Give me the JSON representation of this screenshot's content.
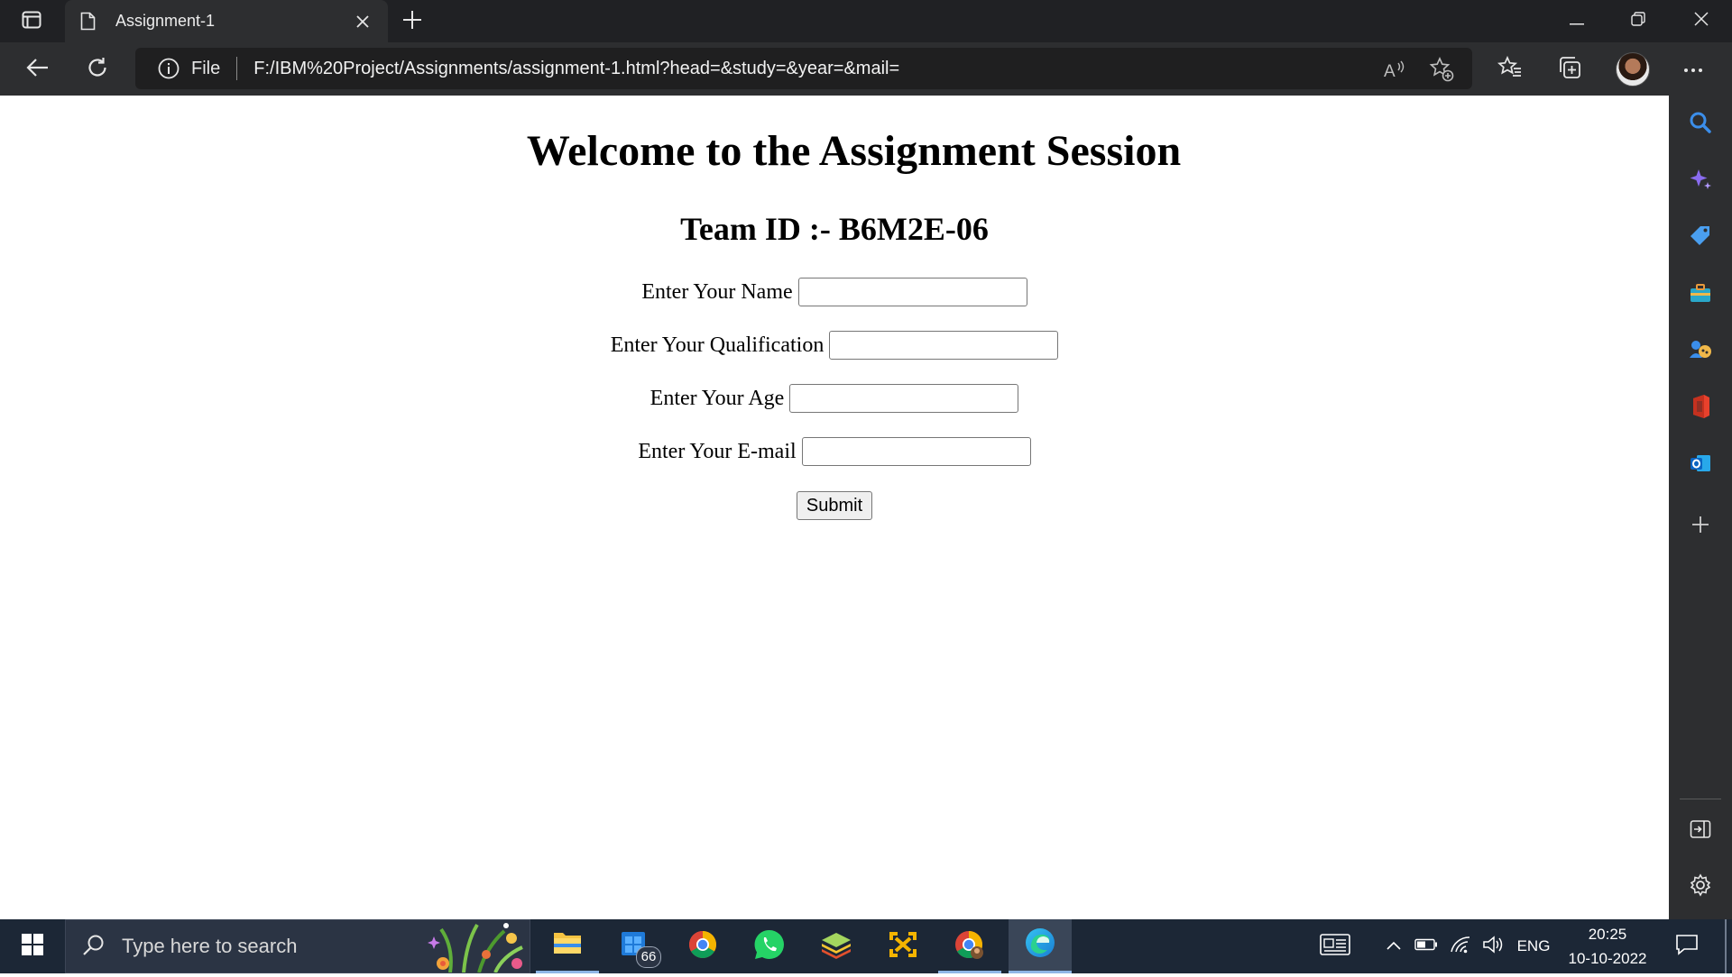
{
  "browser": {
    "tab": {
      "title": "Assignment-1"
    },
    "address": {
      "scheme_label": "File",
      "url": "F:/IBM%20Project/Assignments/assignment-1.html?head=&study=&year=&mail="
    }
  },
  "page": {
    "heading": "Welcome to the Assignment Session",
    "team_heading": "Team ID :- B6M2E-06",
    "form": {
      "fields": [
        {
          "label": "Enter Your Name",
          "value": ""
        },
        {
          "label": "Enter Your Qualification",
          "value": ""
        },
        {
          "label": "Enter Your Age",
          "value": ""
        },
        {
          "label": "Enter Your E-mail",
          "value": ""
        }
      ],
      "submit_label": "Submit"
    }
  },
  "sidebar": {
    "items": [
      "search-icon",
      "discover-sparkle-icon",
      "shopping-tag-icon",
      "tools-briefcase-icon",
      "games-icon",
      "office-icon",
      "outlook-icon",
      "add-icon"
    ],
    "bottom": [
      "hide-sidebar-icon",
      "settings-icon"
    ]
  },
  "taskbar": {
    "search_placeholder": "Type here to search",
    "store_badge": "66",
    "apps": [
      "file-explorer",
      "microsoft-store",
      "chrome",
      "whatsapp",
      "bluestacks",
      "app-icon",
      "chrome-profile",
      "edge"
    ],
    "tray": {
      "language": "ENG",
      "time": "20:25",
      "date": "10-10-2022"
    }
  },
  "colors": {
    "titlebar": "#202124",
    "toolbar": "#2d2e30",
    "taskbar": "#1c2736",
    "sidebar_accent": "#3b8eea"
  }
}
